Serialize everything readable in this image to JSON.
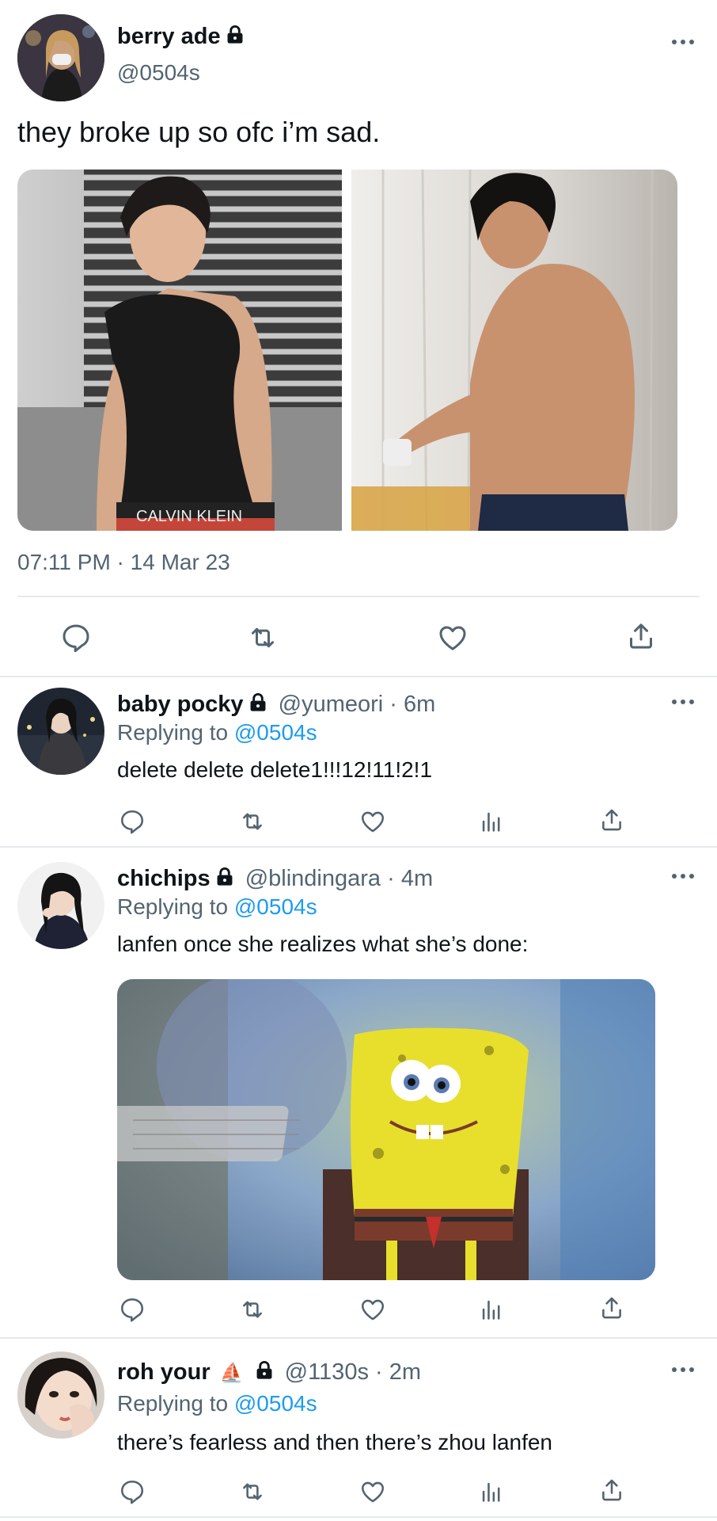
{
  "main_tweet": {
    "display_name": "berry ade",
    "handle": "@0504s",
    "text": "they broke up so ofc i’m sad.",
    "timestamp": "07:11 PM · 14 Mar 23",
    "image_left_text": "CALVIN KLEIN"
  },
  "replies": [
    {
      "display_name": "baby pocky",
      "handle_time": "@yumeori · 6m",
      "replying_label": "Replying to",
      "replying_to": "@0504s",
      "text": "delete delete delete1!!!12!11!2!1"
    },
    {
      "display_name": "chichips",
      "handle_time": "@blindingara · 4m",
      "replying_label": "Replying to",
      "replying_to": "@0504s",
      "text": "lanfen once she realizes what she’s done:"
    },
    {
      "display_name": "roh your",
      "name_emoji": "⛵",
      "handle_time": "@1130s · 2m",
      "replying_label": "Replying to",
      "replying_to": "@0504s",
      "text": "there’s fearless and then there’s zhou lanfen"
    }
  ],
  "colors": {
    "link": "#1d9bf0",
    "muted": "#536471",
    "divider": "#e6e9eb"
  }
}
